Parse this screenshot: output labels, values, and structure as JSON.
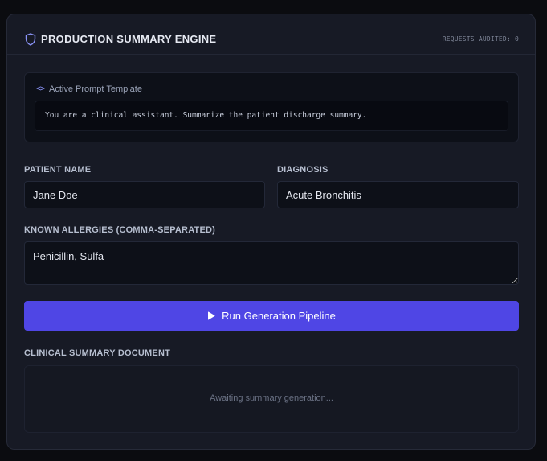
{
  "header": {
    "title": "PRODUCTION SUMMARY ENGINE",
    "counter": "REQUESTS AUDITED: 0"
  },
  "template": {
    "icon": "code-icon",
    "label": "Active Prompt Template",
    "prompt": "You are a clinical assistant. Summarize the patient discharge summary."
  },
  "form": {
    "patient_name_label": "PATIENT NAME",
    "patient_name_value": "Jane Doe",
    "diagnosis_label": "DIAGNOSIS",
    "diagnosis_value": "Acute Bronchitis",
    "allergies_label": "KNOWN ALLERGIES (COMMA-SEPARATED)",
    "allergies_value": "Penicillin, Sulfa"
  },
  "actions": {
    "run_label": "Run Generation Pipeline"
  },
  "output": {
    "label": "CLINICAL SUMMARY DOCUMENT",
    "placeholder": "Awaiting summary generation..."
  },
  "colors": {
    "accent": "#4f46e5",
    "icon_accent": "#8a93f7",
    "background": "#0b0c10",
    "card": "#171a25"
  }
}
